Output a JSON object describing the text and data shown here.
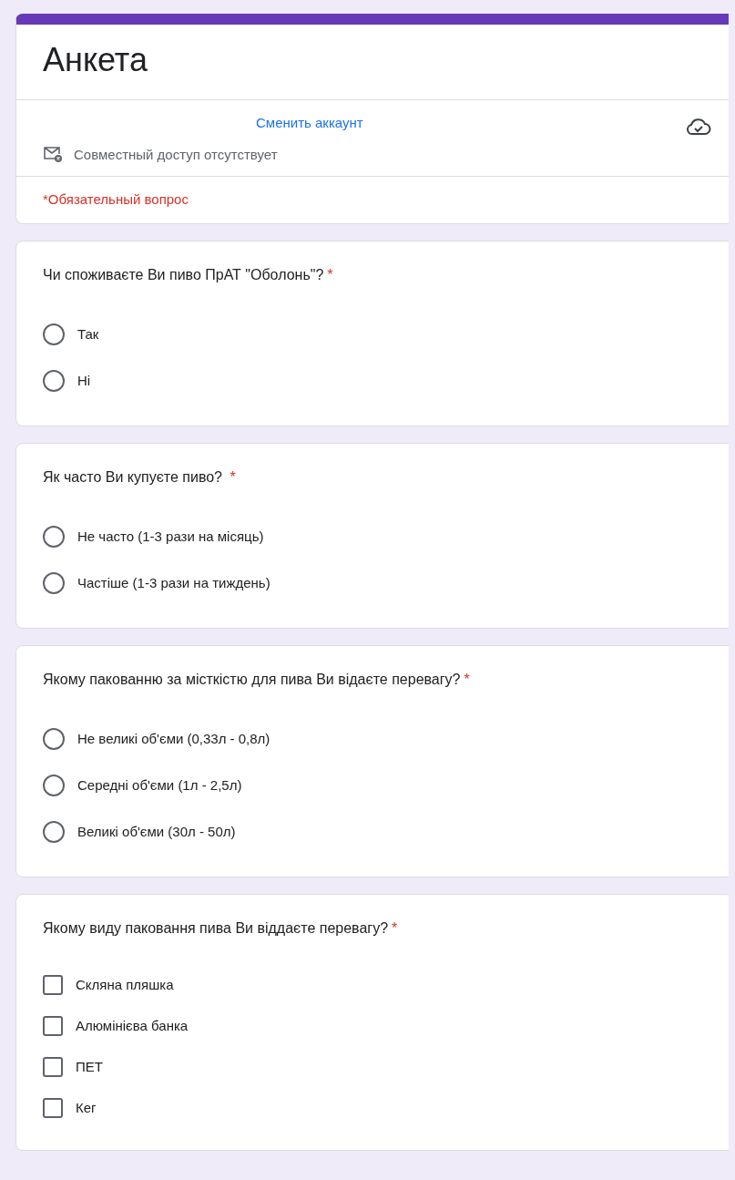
{
  "form": {
    "title": "Анкета",
    "switch_account": "Сменить аккаунт",
    "sharing_status": "Совместный доступ отсутствует",
    "required_note": "*Обязательный вопрос"
  },
  "questions": [
    {
      "kind": "radio",
      "text": "Чи споживаєте Ви пиво ПрАТ \"Оболонь\"?",
      "required_mark": "*",
      "options": [
        {
          "label": "Так",
          "selected": false
        },
        {
          "label": "Ні",
          "selected": false
        }
      ]
    },
    {
      "kind": "radio",
      "text": "Як часто Ви купуєте пиво? ",
      "required_mark": "*",
      "options": [
        {
          "label": "Не часто (1-3 рази на місяць)",
          "selected": false
        },
        {
          "label": "Частіше (1-3 рази на тиждень)",
          "selected": false
        }
      ]
    },
    {
      "kind": "radio",
      "text": "Якому пакованню за місткістю для пива Ви відаєте перевагу?",
      "required_mark": "*",
      "options": [
        {
          "label": "Не великі об'єми (0,33л - 0,8л)",
          "selected": false
        },
        {
          "label": "Середні об'єми (1л - 2,5л)",
          "selected": false
        },
        {
          "label": "Великі об'єми (30л - 50л)",
          "selected": false
        }
      ]
    },
    {
      "kind": "checkbox",
      "text": "Якому виду паковання пива Ви віддаєте перевагу?",
      "required_mark": "*",
      "options": [
        {
          "label": "Скляна пляшка",
          "checked": false
        },
        {
          "label": "Алюмінієва банка",
          "checked": false
        },
        {
          "label": "ПЕТ",
          "checked": false
        },
        {
          "label": "Кег",
          "checked": false
        }
      ]
    }
  ]
}
